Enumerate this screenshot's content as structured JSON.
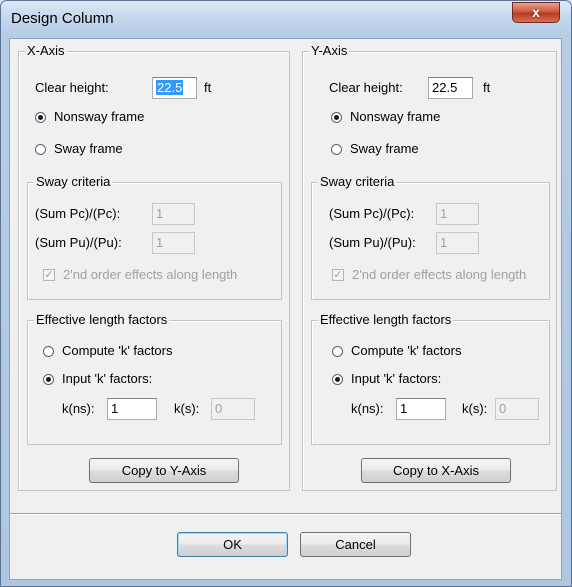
{
  "window": {
    "title": "Design Column",
    "close_glyph": "x"
  },
  "x_axis": {
    "group_title": "X-Axis",
    "clear_height_label": "Clear height:",
    "clear_height_value": "22.5",
    "clear_height_unit": "ft",
    "nonsway_label": "Nonsway frame",
    "sway_label": "Sway frame",
    "frame_selected": "nonsway",
    "sway_criteria": {
      "title": "Sway criteria",
      "pc_label": "(Sum Pc)/(Pc):",
      "pc_value": "1",
      "pu_label": "(Sum Pu)/(Pu):",
      "pu_value": "1",
      "second_order_label": "2'nd order effects along length",
      "second_order_checked": true
    },
    "effective_length": {
      "title": "Effective length factors",
      "compute_label": "Compute 'k' factors",
      "input_label": "Input 'k' factors:",
      "selected": "input",
      "kns_label": "k(ns):",
      "kns_value": "1",
      "ks_label": "k(s):",
      "ks_value": "0"
    },
    "copy_button": "Copy to Y-Axis"
  },
  "y_axis": {
    "group_title": "Y-Axis",
    "clear_height_label": "Clear height:",
    "clear_height_value": "22.5",
    "clear_height_unit": "ft",
    "nonsway_label": "Nonsway frame",
    "sway_label": "Sway frame",
    "frame_selected": "nonsway",
    "sway_criteria": {
      "title": "Sway criteria",
      "pc_label": "(Sum Pc)/(Pc):",
      "pc_value": "1",
      "pu_label": "(Sum Pu)/(Pu):",
      "pu_value": "1",
      "second_order_label": "2'nd order effects along length",
      "second_order_checked": true
    },
    "effective_length": {
      "title": "Effective length factors",
      "compute_label": "Compute 'k' factors",
      "input_label": "Input 'k' factors:",
      "selected": "input",
      "kns_label": "k(ns):",
      "kns_value": "1",
      "ks_label": "k(s):",
      "ks_value": "0"
    },
    "copy_button": "Copy to X-Axis"
  },
  "buttons": {
    "ok": "OK",
    "cancel": "Cancel"
  }
}
